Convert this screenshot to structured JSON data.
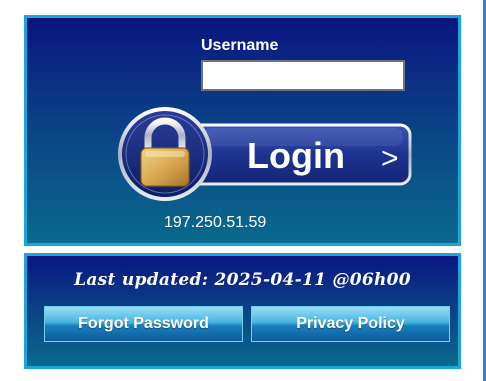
{
  "login": {
    "username_label": "Username",
    "username_value": "",
    "login_button_label": "Login",
    "login_button_arrow": ">",
    "ip_address": "197.250.51.59"
  },
  "footer": {
    "last_updated": "Last updated: 2025-04-11 @06h00",
    "forgot_password_label": "Forgot Password",
    "privacy_policy_label": "Privacy Policy"
  },
  "icons": {
    "lock": "padlock-icon"
  },
  "colors": {
    "panel_border": "#1aa6dc",
    "panel_top": "#0a1580",
    "panel_bottom": "#0a6a8c",
    "button_highlight": "#9adff5",
    "page_edge": "#2f86d6"
  }
}
